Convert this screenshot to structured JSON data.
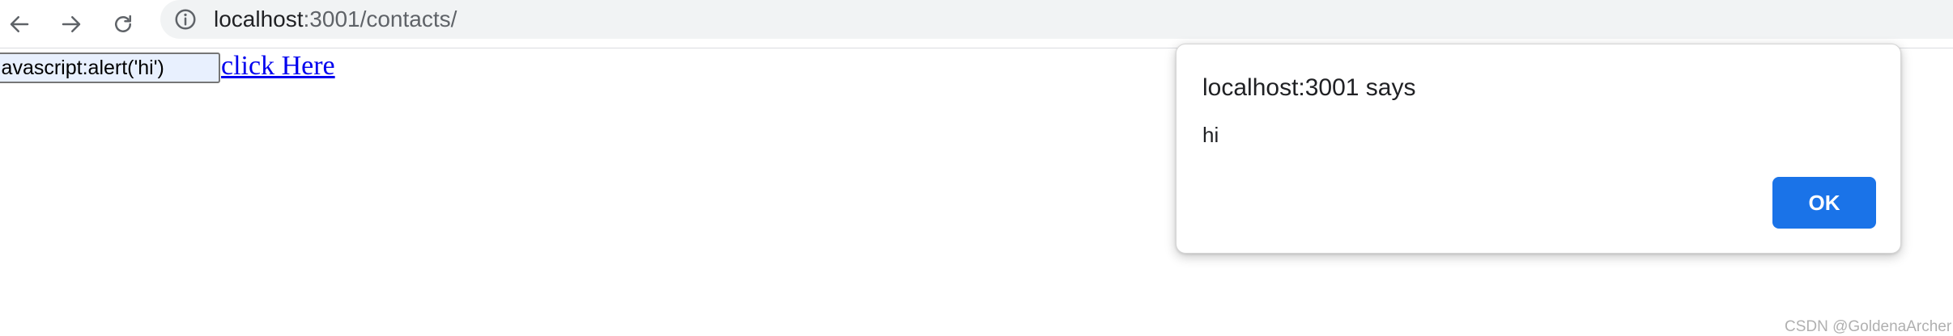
{
  "browser": {
    "back_icon": "arrow-left-icon",
    "forward_icon": "arrow-right-icon",
    "reload_icon": "reload-icon",
    "site_info_icon": "info-circle-icon",
    "url_host": "localhost",
    "url_rest": ":3001/contacts/"
  },
  "page": {
    "input_value": "javascript:alert('hi')",
    "link_text": "click Here"
  },
  "alert_dialog": {
    "title": "localhost:3001 says",
    "message": "hi",
    "ok_label": "OK"
  },
  "watermark": "CSDN @GoldenaArcher",
  "colors": {
    "accent": "#1a73e8",
    "link": "#0000ee",
    "omnibox_bg": "#f1f3f4",
    "input_bg": "#e8f0fe"
  }
}
